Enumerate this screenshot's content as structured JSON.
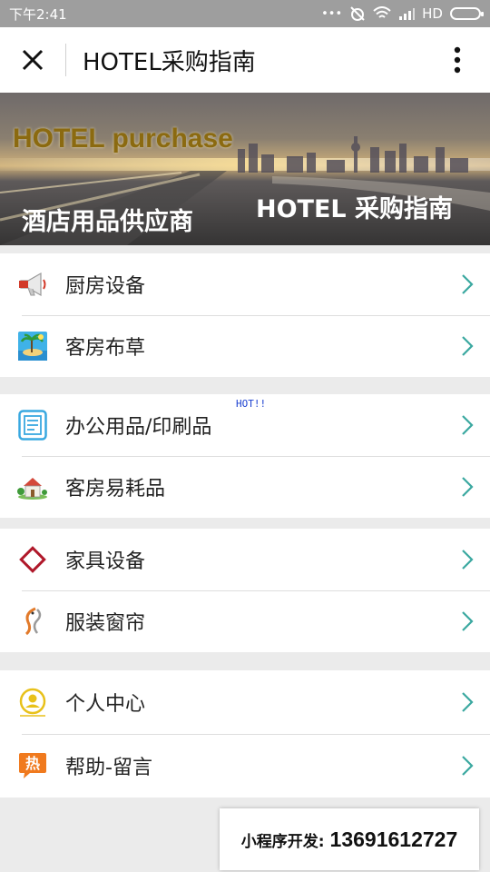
{
  "status_bar": {
    "time": "下午2:41",
    "network": "HD"
  },
  "navbar": {
    "title": "HOTEL采购指南"
  },
  "banner": {
    "english_title": "HOTEL purchase",
    "chinese_subtitle": "酒店用品供应商",
    "chinese_title": "HOTEL 采购指南"
  },
  "menu": {
    "group1": [
      {
        "label": "厨房设备",
        "icon": "megaphone-icon"
      },
      {
        "label": "客房布草",
        "icon": "beach-icon"
      }
    ],
    "group2": [
      {
        "label": "办公用品/印刷品",
        "icon": "document-icon",
        "badge": "HOT!!"
      },
      {
        "label": "客房易耗品",
        "icon": "house-icon"
      }
    ],
    "group3": [
      {
        "label": "家具设备",
        "icon": "diamond-icon"
      },
      {
        "label": "服装窗帘",
        "icon": "fish-icon"
      }
    ],
    "group4": [
      {
        "label": "个人中心",
        "icon": "user-circle-icon"
      },
      {
        "label": "帮助-留言",
        "icon": "hot-chat-icon",
        "icon_text": "热"
      }
    ]
  },
  "footer": {
    "label": "小程序开发:",
    "phone": "13691612727"
  },
  "colors": {
    "arrow": "#3aa8a0",
    "status_bar": "#9e9e9e"
  }
}
